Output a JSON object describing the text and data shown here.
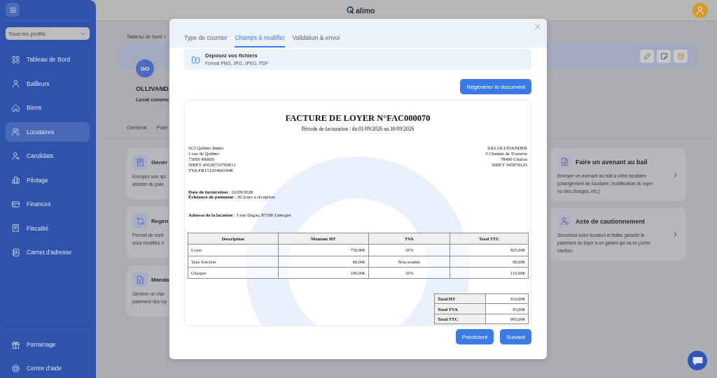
{
  "top_bar": {
    "logo": "alimo"
  },
  "sidebar": {
    "profile_filter": "Tous les profils",
    "items": [
      {
        "label": "Tableau de Bord",
        "selected": false
      },
      {
        "label": "Bailleurs",
        "selected": false
      },
      {
        "label": "Biens",
        "selected": false
      },
      {
        "label": "Locataires",
        "selected": true
      },
      {
        "label": "Candidats",
        "selected": false
      },
      {
        "label": "Pilotage",
        "selected": false
      },
      {
        "label": "Finances",
        "selected": false
      },
      {
        "label": "Fiscalité",
        "selected": false
      },
      {
        "label": "Carnet d'adresse",
        "selected": false
      }
    ],
    "footer_items": [
      {
        "label": "Parrainage"
      },
      {
        "label": "Centre d'aide"
      }
    ]
  },
  "tenant_page": {
    "breadcrumb": "Tableau de bord >",
    "initials": "GO",
    "name": "OLLIVAND",
    "subtitle": "Local comme",
    "tabs": [
      {
        "label": "Général"
      },
      {
        "label": "Paie"
      }
    ],
    "left_cards": [
      {
        "title": "Génér",
        "lines": [
          "Envoyez une qui",
          "attester du paie"
        ]
      },
      {
        "title": "Regén",
        "lines": [
          "Permet de mett",
          "vous modifiez u"
        ]
      },
      {
        "title": "Manda",
        "lines": [
          "Générer un mar",
          "paiement des loy"
        ]
      }
    ],
    "right_cards": [
      {
        "title": "Faire un avenant au bail",
        "lines": [
          "Envoyer un avenant au bail à votre locataire",
          "(changement de locataire, modification du loyer",
          "ou des charges, etc.)"
        ]
      },
      {
        "title": "Acte de cautionnement",
        "lines": [
          "Sécurisez votre location et faites garantir le",
          "paiement du loyer à un garant qui va se porter",
          "caution."
        ]
      }
    ]
  },
  "modal": {
    "tabs": [
      {
        "label": "Type de courrier",
        "selected": false
      },
      {
        "label": "Champs à modifier",
        "selected": true
      },
      {
        "label": "Validation & envoi",
        "selected": false
      }
    ],
    "dropzone": {
      "title": "Déposez vos fichiers",
      "hint": "Format PNG, JPG, JPEG, PDF"
    },
    "regenerate_button": "Regénérer le document",
    "document": {
      "title": "FACTURE DE LOYER N°FAC000070",
      "period": "Période de facturation : du 01/09/2026 au 30/09/2026",
      "issuer": [
        "SCI Qalimo Immo",
        "1 rue de Qalimo",
        "75000 PARIS",
        "SIRET 45029719700011",
        "TVA FR151254665448"
      ],
      "recipient": [
        "SAS OLLIVANDER",
        "3 Chemin de Traverse",
        "78400 Chatou",
        "SIRET 345876123"
      ],
      "dates": [
        "**Date de facturation** : 22/09/2026",
        "**Échéance de paiement** : 30 jours à réception"
      ],
      "rental_address": "**Adresse de la location** : 3 rue Degas, 87100 Limoges",
      "table": {
        "columns": [
          "Description",
          "Montant HT",
          "TVA",
          "Total TTC"
        ],
        "rows": [
          [
            "Loyer",
            "750,00€",
            "10%",
            "825,00€"
          ],
          [
            "Taxe foncière",
            "60,00€",
            "Non soumis",
            "60,00€"
          ],
          [
            "Charges",
            "100,00€",
            "10%",
            "110,00€"
          ]
        ]
      },
      "totals": [
        {
          "label": "Total HT",
          "value": "910,00€"
        },
        {
          "label": "Total TVA",
          "value": "85,00€"
        },
        {
          "label": "Total TTC",
          "value": "995,00€"
        }
      ]
    },
    "buttons": [
      {
        "label": "Précédent"
      },
      {
        "label": "Suivant"
      }
    ]
  }
}
